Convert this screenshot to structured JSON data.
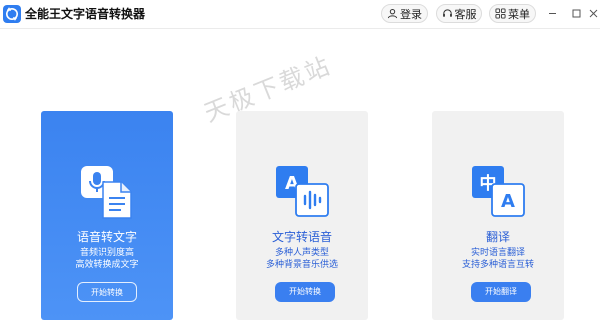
{
  "app": {
    "title": "全能王文字语音转换器",
    "accent": "#3b83f0"
  },
  "toolbar": {
    "login_label": "登录",
    "login_icon": "user-icon",
    "service_label": "客服",
    "service_icon": "headset-icon",
    "menu_label": "菜单",
    "menu_icon": "grid-icon"
  },
  "window": {
    "minimize_icon": "minimize-icon",
    "maximize_icon": "maximize-icon",
    "close_icon": "close-icon"
  },
  "watermark": "天极下载站",
  "cards": [
    {
      "title": "语音转文字",
      "desc_line1": "音频识别度高",
      "desc_line2": "高效转换成文字",
      "button": "开始转换",
      "icon": "microphone-document-icon",
      "active": true
    },
    {
      "title": "文字转语音",
      "desc_line1": "多种人声类型",
      "desc_line2": "多种背景音乐供选",
      "button": "开始转换",
      "icon": "text-to-audio-icon",
      "active": false
    },
    {
      "title": "翻译",
      "desc_line1": "实时语言翻译",
      "desc_line2": "支持多种语言互转",
      "button": "开始翻译",
      "icon": "translate-icon",
      "active": false
    }
  ]
}
